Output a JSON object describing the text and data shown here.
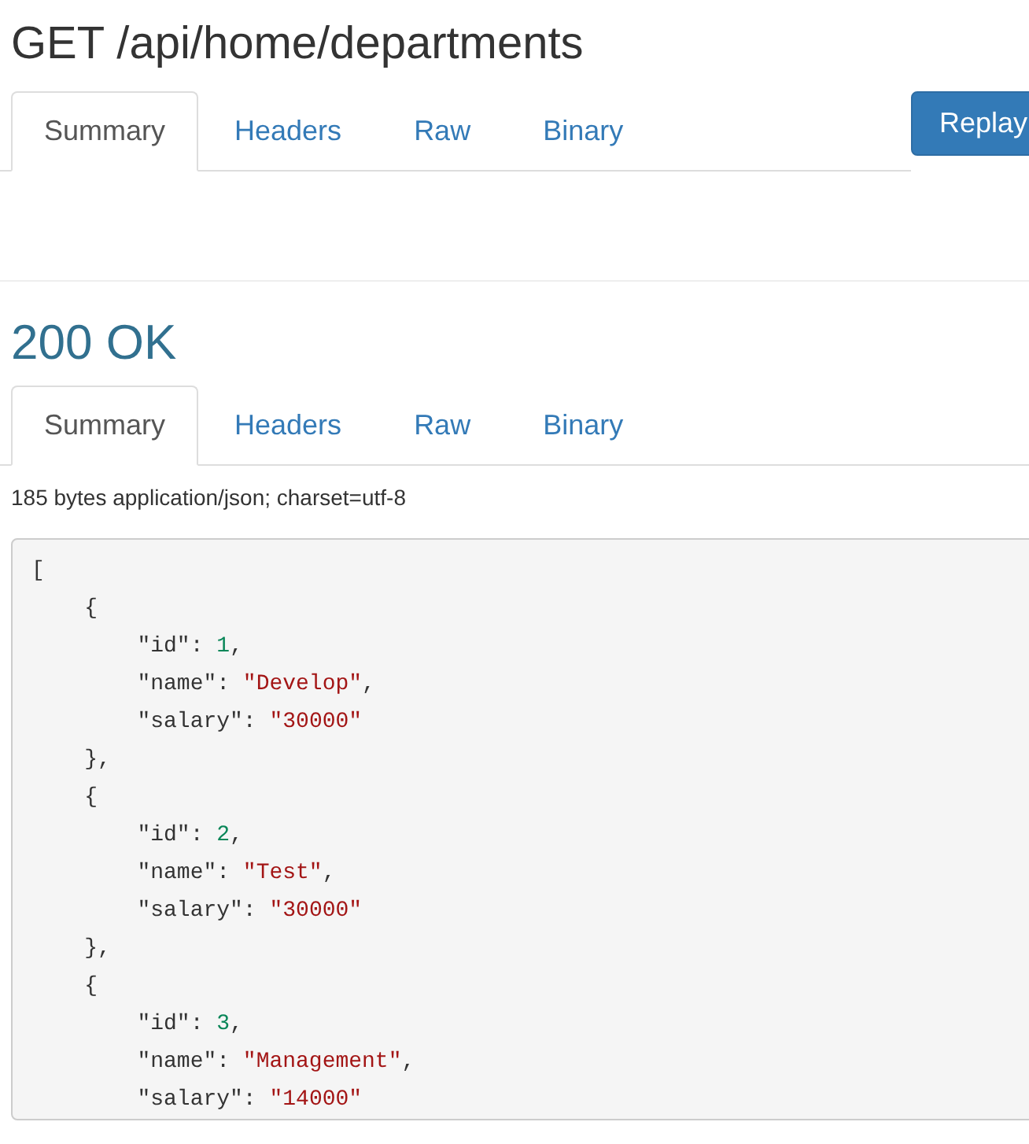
{
  "request": {
    "title": "GET /api/home/departments",
    "tabs": [
      {
        "label": "Summary",
        "selected": true
      },
      {
        "label": "Headers",
        "selected": false
      },
      {
        "label": "Raw",
        "selected": false
      },
      {
        "label": "Binary",
        "selected": false
      }
    ],
    "replay_button": "Replay"
  },
  "response": {
    "status": "200 OK",
    "tabs": [
      {
        "label": "Summary",
        "selected": true
      },
      {
        "label": "Headers",
        "selected": false
      },
      {
        "label": "Raw",
        "selected": false
      },
      {
        "label": "Binary",
        "selected": false
      }
    ],
    "content_info": "185 bytes application/json; charset=utf-8",
    "body_lines": [
      [
        {
          "kind": "punct",
          "text": "["
        }
      ],
      [
        {
          "kind": "punct",
          "text": "    {"
        }
      ],
      [
        {
          "kind": "key",
          "text": "        \"id\": "
        },
        {
          "kind": "number",
          "text": "1"
        },
        {
          "kind": "punct",
          "text": ","
        }
      ],
      [
        {
          "kind": "key",
          "text": "        \"name\": "
        },
        {
          "kind": "string",
          "text": "\"Develop\""
        },
        {
          "kind": "punct",
          "text": ","
        }
      ],
      [
        {
          "kind": "key",
          "text": "        \"salary\": "
        },
        {
          "kind": "string",
          "text": "\"30000\""
        }
      ],
      [
        {
          "kind": "punct",
          "text": "    },"
        }
      ],
      [
        {
          "kind": "punct",
          "text": "    {"
        }
      ],
      [
        {
          "kind": "key",
          "text": "        \"id\": "
        },
        {
          "kind": "number",
          "text": "2"
        },
        {
          "kind": "punct",
          "text": ","
        }
      ],
      [
        {
          "kind": "key",
          "text": "        \"name\": "
        },
        {
          "kind": "string",
          "text": "\"Test\""
        },
        {
          "kind": "punct",
          "text": ","
        }
      ],
      [
        {
          "kind": "key",
          "text": "        \"salary\": "
        },
        {
          "kind": "string",
          "text": "\"30000\""
        }
      ],
      [
        {
          "kind": "punct",
          "text": "    },"
        }
      ],
      [
        {
          "kind": "punct",
          "text": "    {"
        }
      ],
      [
        {
          "kind": "key",
          "text": "        \"id\": "
        },
        {
          "kind": "number",
          "text": "3"
        },
        {
          "kind": "punct",
          "text": ","
        }
      ],
      [
        {
          "kind": "key",
          "text": "        \"name\": "
        },
        {
          "kind": "string",
          "text": "\"Management\""
        },
        {
          "kind": "punct",
          "text": ","
        }
      ],
      [
        {
          "kind": "key",
          "text": "        \"salary\": "
        },
        {
          "kind": "string",
          "text": "\"14000\""
        }
      ]
    ]
  }
}
